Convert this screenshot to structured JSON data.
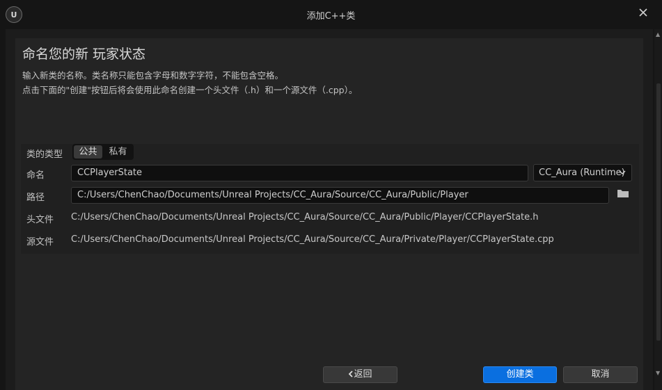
{
  "window": {
    "title": "添加C++类",
    "logo_text": "U"
  },
  "page": {
    "heading": "命名您的新 玩家状态",
    "desc_line1": "输入新类的名称。类名称只能包含字母和数字字符，不能包含空格。",
    "desc_line2": "点击下面的\"创建\"按钮后将会使用此命名创建一个头文件（.h）和一个源文件（.cpp）。"
  },
  "form": {
    "class_type_label": "类的类型",
    "class_type_options": [
      "公共",
      "私有"
    ],
    "class_type_selected": "公共",
    "name_label": "命名",
    "name_value": "CCPlayerState",
    "module_value": "CC_Aura (Runtime)",
    "path_label": "路径",
    "path_value": "C:/Users/ChenChao/Documents/Unreal Projects/CC_Aura/Source/CC_Aura/Public/Player",
    "header_label": "头文件",
    "header_value": "C:/Users/ChenChao/Documents/Unreal Projects/CC_Aura/Source/CC_Aura/Public/Player/CCPlayerState.h",
    "source_label": "源文件",
    "source_value": "C:/Users/ChenChao/Documents/Unreal Projects/CC_Aura/Source/CC_Aura/Private/Player/CCPlayerState.cpp"
  },
  "buttons": {
    "back": "返回",
    "create": "创建类",
    "cancel": "取消"
  },
  "colors": {
    "accent": "#0a6fe0",
    "background": "#242424"
  }
}
